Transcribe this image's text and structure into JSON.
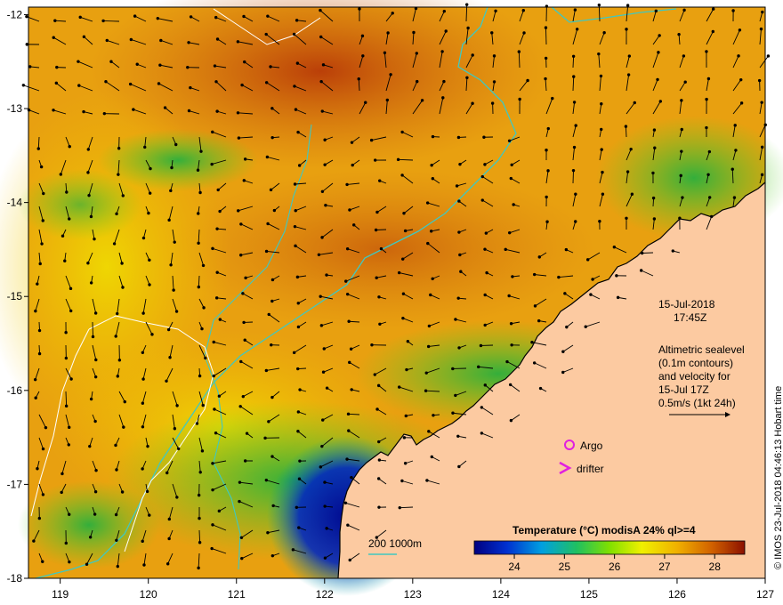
{
  "map": {
    "x_ticks": [
      "119",
      "120",
      "121",
      "122",
      "123",
      "124",
      "125",
      "126",
      "127"
    ],
    "y_ticks": [
      "-12",
      "-13",
      "-14",
      "-15",
      "-16",
      "-17",
      "-18"
    ],
    "date": "15-Jul-2018",
    "time": "17:45Z",
    "altimetry_lines": [
      "Altimetric sealevel",
      "(0.1m contours)",
      "and velocity for",
      "15-Jul 17Z",
      "0.5m/s (1kt 24h)"
    ],
    "legend_argo": "Argo",
    "legend_drifter": "drifter",
    "bathymetry_label": "200  1000m",
    "colorbar_title": "Temperature  (°C) modisA 24% ql>=4",
    "colorbar_ticks": [
      "24",
      "25",
      "26",
      "27",
      "28"
    ],
    "credit": "© IMOS 23-Jul-2018 04:46:13 Hobart time",
    "colors": {
      "land": "#fccaa1",
      "argo": "#e020e0",
      "bathy_200": "#40c8c0",
      "bathy_1000": "#ffffff"
    }
  }
}
